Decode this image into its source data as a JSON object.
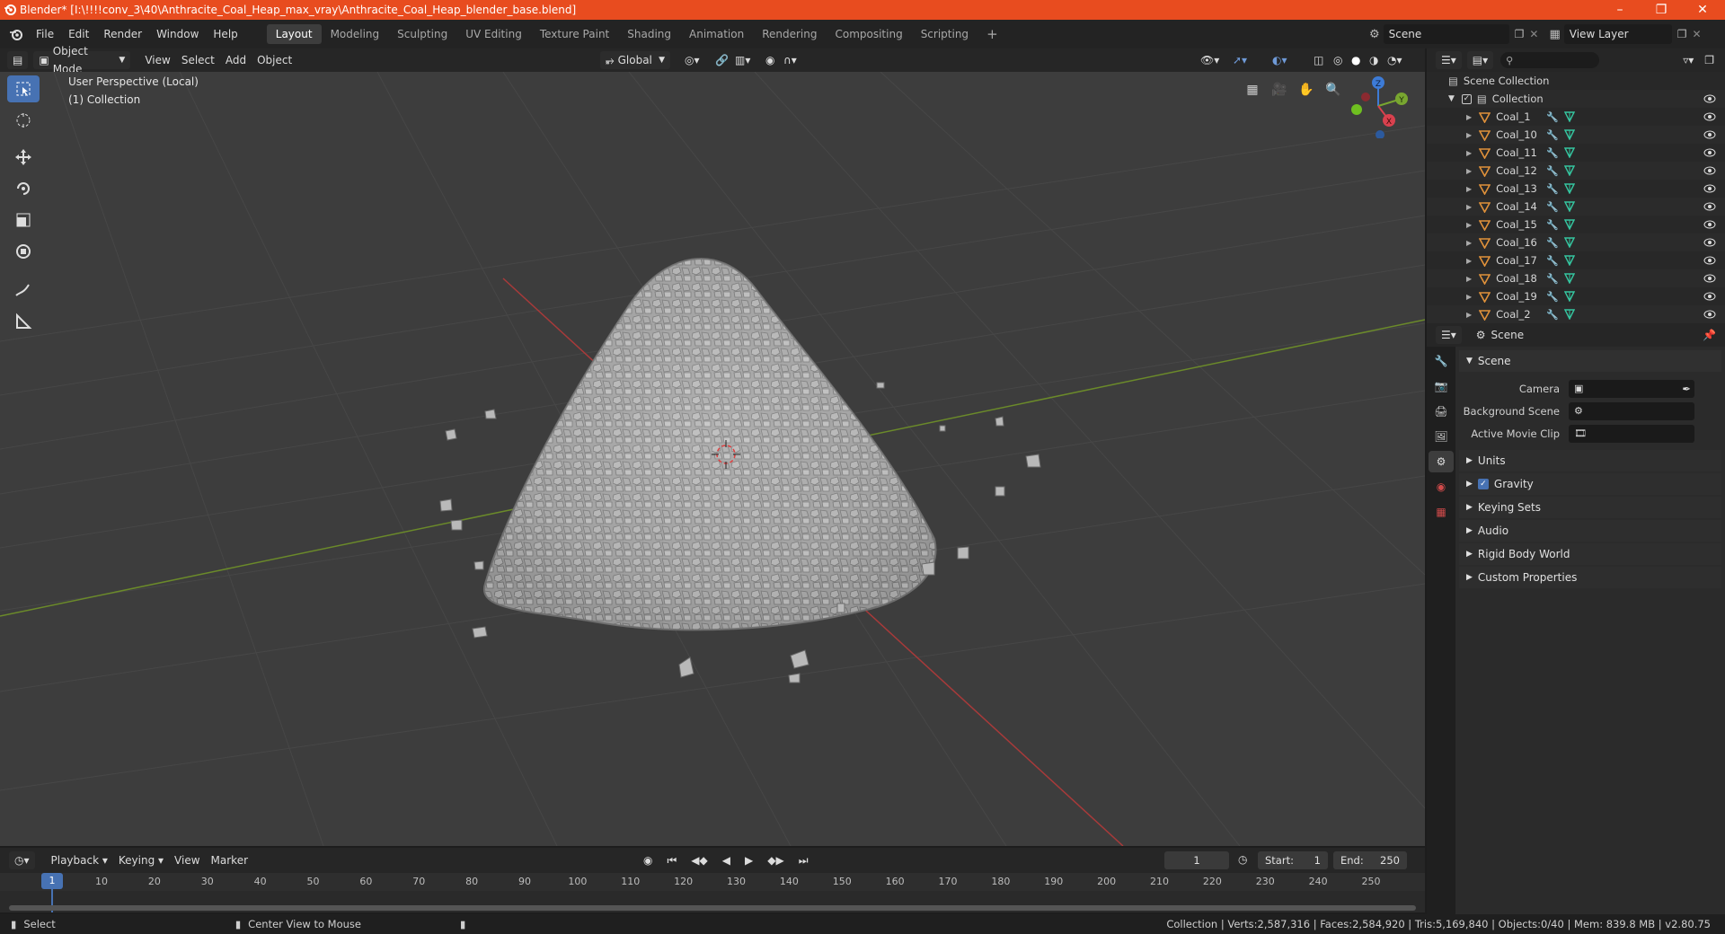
{
  "window": {
    "title": "Blender* [I:\\!!!!conv_3\\40\\Anthracite_Coal_Heap_max_vray\\Anthracite_Coal_Heap_blender_base.blend]",
    "minimize": "–",
    "maximize": "❐",
    "close": "✕"
  },
  "menu": [
    "File",
    "Edit",
    "Render",
    "Window",
    "Help"
  ],
  "workspaces": [
    "Layout",
    "Modeling",
    "Sculpting",
    "UV Editing",
    "Texture Paint",
    "Shading",
    "Animation",
    "Rendering",
    "Compositing",
    "Scripting"
  ],
  "workspace_add": "+",
  "scene_selector": "Scene",
  "view_layer": "View Layer",
  "viewport_header": {
    "mode": "Object Mode",
    "menus": [
      "View",
      "Select",
      "Add",
      "Object"
    ],
    "orientation": "Global"
  },
  "viewport": {
    "perspective": "User Perspective (Local)",
    "collection": "(1) Collection",
    "gizmo": {
      "x": "X",
      "y": "Y",
      "z": "Z"
    }
  },
  "outliner": {
    "root": "Scene Collection",
    "collection": "Collection",
    "items": [
      "Coal_1",
      "Coal_10",
      "Coal_11",
      "Coal_12",
      "Coal_13",
      "Coal_14",
      "Coal_15",
      "Coal_16",
      "Coal_17",
      "Coal_18",
      "Coal_19",
      "Coal_2"
    ]
  },
  "properties": {
    "context": "Scene",
    "panel": "Scene",
    "fields": [
      {
        "label": "Camera",
        "value": ""
      },
      {
        "label": "Background Scene",
        "value": ""
      },
      {
        "label": "Active Movie Clip",
        "value": ""
      }
    ],
    "sections": [
      "Units",
      "Gravity",
      "Keying Sets",
      "Audio",
      "Rigid Body World",
      "Custom Properties"
    ],
    "gravity_checked": true
  },
  "timeline": {
    "menus": [
      "Playback",
      "Keying",
      "View",
      "Marker"
    ],
    "current_frame": "1",
    "start_label": "Start:",
    "start": "1",
    "end_label": "End:",
    "end": "250",
    "ruler": [
      "10",
      "20",
      "30",
      "40",
      "50",
      "60",
      "70",
      "80",
      "90",
      "100",
      "110",
      "120",
      "130",
      "140",
      "150",
      "160",
      "170",
      "180",
      "190",
      "200",
      "210",
      "220",
      "230",
      "240",
      "250"
    ],
    "playhead": "1"
  },
  "status": {
    "left": "Select",
    "middle": "Center View to Mouse",
    "right": "Collection | Verts:2,587,316 | Faces:2,584,920 | Tris:5,169,840 | Objects:0/40 | Mem: 839.8 MB | v2.80.75"
  },
  "colors": {
    "accent": "#4772b3",
    "titlebar": "#e84c1f",
    "x_axis": "#c44040",
    "y_axis": "#7a9a2c",
    "mesh_orange": "#e0913a",
    "data_green": "#35c6a0"
  }
}
